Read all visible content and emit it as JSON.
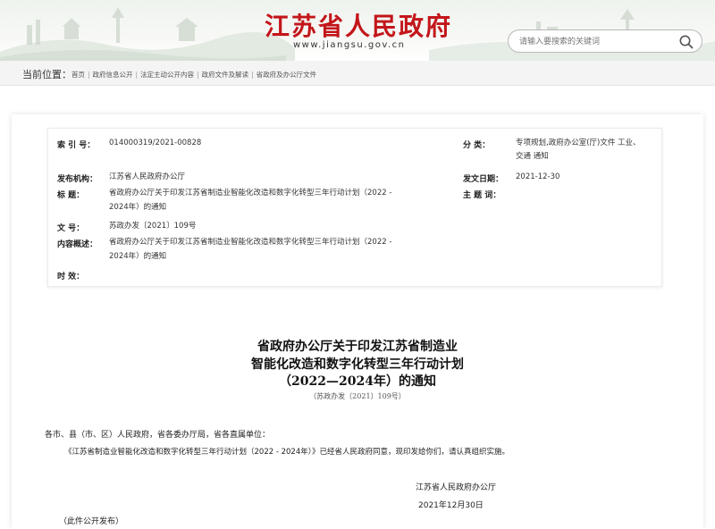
{
  "header": {
    "site_title": "江苏省人民政府",
    "site_url": "www.jiangsu.gov.cn",
    "search_placeholder": "请输入要搜索的关键词"
  },
  "breadcrumb": {
    "label": "当前位置：",
    "items": [
      "首页",
      "政府信息公开",
      "法定主动公开内容",
      "政府文件及解读",
      "省政府及办公厅文件"
    ]
  },
  "meta": {
    "index_label": "索 引 号：",
    "index_value": "014000319/2021-00828",
    "category_label": "分 类：",
    "category_value_1": "专项规划,政府办公室(厅)文件 工业、",
    "category_value_2": "交通 通知",
    "issuer_label": "发布机构：",
    "issuer_value": "江苏省人民政府办公厅",
    "date_label": "发文日期：",
    "date_value": "2021-12-30",
    "title_label": "标 题：",
    "title_value_1": "省政府办公厅关于印发江苏省制造业智能化改造和数字化转型三年行动计划（2022 -",
    "title_value_2": "2024年）的通知",
    "subject_label": "主 题 词：",
    "subject_value": "",
    "docno_label": "文 号：",
    "docno_value": "苏政办发〔2021〕109号",
    "summary_label": "内容概述：",
    "summary_value_1": "省政府办公厅关于印发江苏省制造业智能化改造和数字化转型三年行动计划（2022 -",
    "summary_value_2": "2024年）的通知",
    "validity_label": "时 效：",
    "validity_value": ""
  },
  "document": {
    "title_line_1": "省政府办公厅关于印发江苏省制造业",
    "title_line_2": "智能化改造和数字化转型三年行动计划",
    "title_line_3": "（2022—2024年）的通知",
    "doc_number": "（苏政办发〔2021〕109号）",
    "addressee": "各市、县（市、区）人民政府，省各委办厅局，省各直属单位：",
    "body": "《江苏省制造业智能化改造和数字化转型三年行动计划（2022 - 2024年）》已经省人民政府同意，现印发给你们，请认真组织实施。",
    "signature_org": "江苏省人民政府办公厅",
    "signature_date": "2021年12月30日",
    "footnote": "（此件公开发布）"
  },
  "colors": {
    "brand_red": "#c3161b",
    "breadcrumb_bg": "#f4f4f4"
  }
}
